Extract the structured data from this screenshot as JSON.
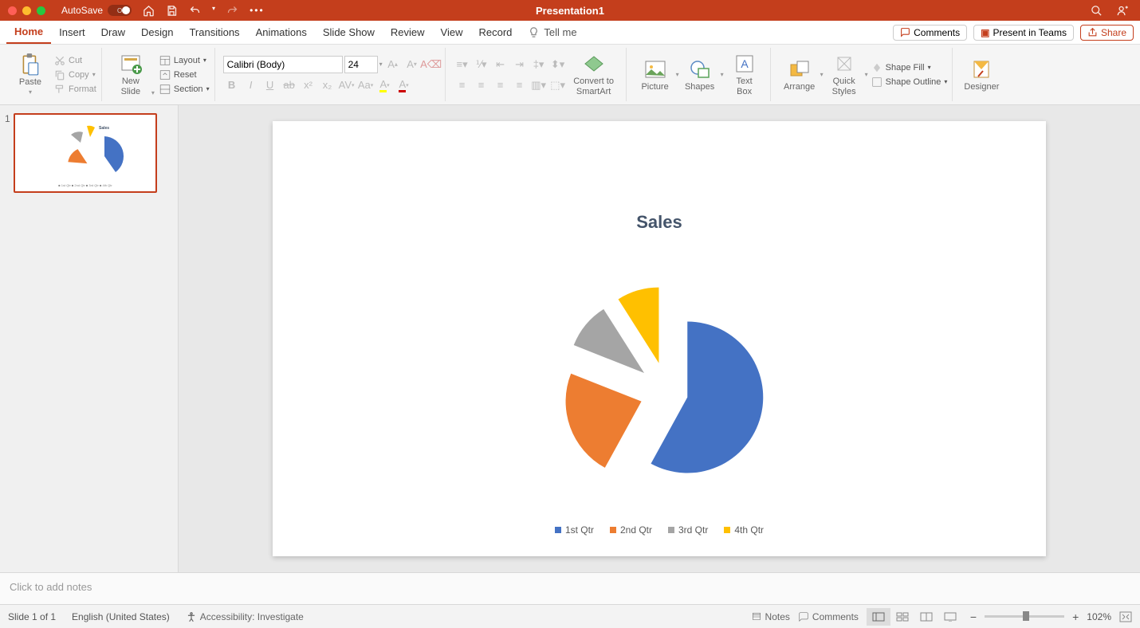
{
  "titlebar": {
    "autosave_label": "AutoSave",
    "autosave_state": "OFF",
    "title": "Presentation1"
  },
  "tabs": {
    "items": [
      "Home",
      "Insert",
      "Draw",
      "Design",
      "Transitions",
      "Animations",
      "Slide Show",
      "Review",
      "View",
      "Record"
    ],
    "active": "Home",
    "tell_me": "Tell me"
  },
  "tabs_right": {
    "comments": "Comments",
    "present": "Present in Teams",
    "share": "Share"
  },
  "ribbon": {
    "paste": "Paste",
    "cut": "Cut",
    "copy": "Copy",
    "format": "Format",
    "new_slide": "New\nSlide",
    "layout": "Layout",
    "reset": "Reset",
    "section": "Section",
    "font_name": "Calibri (Body)",
    "font_size": "24",
    "convert": "Convert to\nSmartArt",
    "picture": "Picture",
    "shapes": "Shapes",
    "textbox": "Text\nBox",
    "arrange": "Arrange",
    "quick_styles": "Quick\nStyles",
    "shape_fill": "Shape Fill",
    "shape_outline": "Shape Outline",
    "designer": "Designer"
  },
  "thumbs": {
    "num": "1"
  },
  "chart_data": {
    "type": "pie",
    "title": "Sales",
    "categories": [
      "1st Qtr",
      "2nd Qtr",
      "3rd Qtr",
      "4th Qtr"
    ],
    "values": [
      58,
      23,
      10,
      9
    ],
    "colors": [
      "#4472c4",
      "#ed7d31",
      "#a5a5a5",
      "#ffc000"
    ],
    "exploded": true
  },
  "notes": {
    "placeholder": "Click to add notes"
  },
  "status": {
    "slide": "Slide 1 of 1",
    "lang": "English (United States)",
    "accessibility": "Accessibility: Investigate",
    "notes_btn": "Notes",
    "comments_btn": "Comments",
    "zoom": "102%"
  }
}
